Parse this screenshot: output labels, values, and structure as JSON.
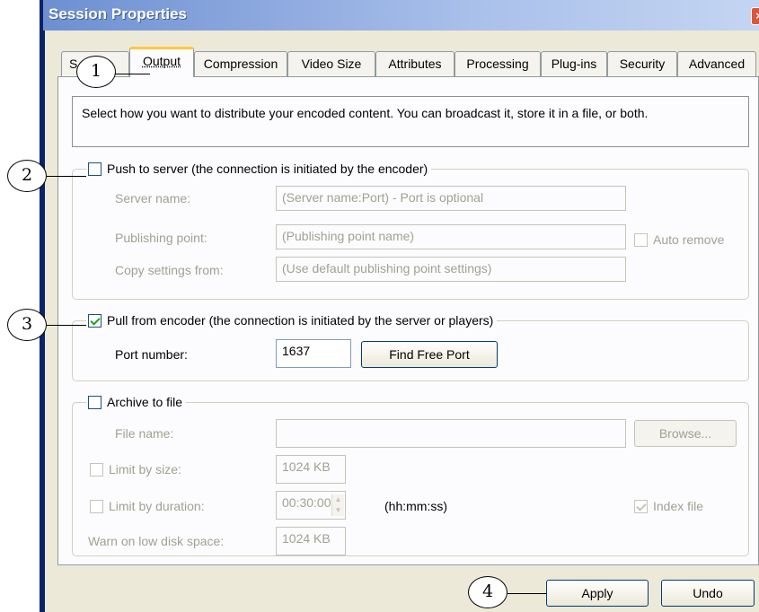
{
  "window": {
    "title": "Session Properties",
    "close_glyph": "×"
  },
  "tabs": [
    "Sources",
    "Output",
    "Compression",
    "Video Size",
    "Attributes",
    "Processing",
    "Plug-ins",
    "Security",
    "Advanced"
  ],
  "tab_visible_fragment_first": "S",
  "tab_visible_fragment_second": "es",
  "description": "Select how you want to distribute your encoded content. You can broadcast it, store it in a file, or both.",
  "push": {
    "label": "Push to server (the connection is initiated by the encoder)",
    "checked": false,
    "server_name_label": "Server name:",
    "server_name_value": "(Server name:Port)  - Port is optional",
    "publishing_point_label": "Publishing point:",
    "publishing_point_value": "(Publishing point name)",
    "auto_remove_label": "Auto remove",
    "copy_settings_label": "Copy settings from:",
    "copy_settings_value": "(Use default publishing point settings)"
  },
  "pull": {
    "label": "Pull from encoder (the connection is initiated by the server or players)",
    "checked": true,
    "port_label": "Port number:",
    "port_value": "1637",
    "find_port_button": "Find Free Port"
  },
  "archive": {
    "label": "Archive to file",
    "checked": false,
    "file_name_label": "File name:",
    "file_name_value": "",
    "browse_button": "Browse...",
    "limit_size_label": "Limit by size:",
    "limit_size_value": "1024 KB",
    "limit_duration_label": "Limit by duration:",
    "limit_duration_value": "00:30:00",
    "duration_format": "(hh:mm:ss)",
    "index_file_label": "Index file",
    "index_file_checked": true,
    "warn_label": "Warn on low disk space:",
    "warn_value": "1024 KB"
  },
  "footer": {
    "apply_button": "Apply",
    "undo_button": "Undo"
  },
  "callouts": [
    "1",
    "2",
    "3",
    "4"
  ],
  "colors": {
    "title_gradient_start": "#6d8fd2",
    "active_tab_accent": "#ffc83c",
    "checkbox_check": "#21a121",
    "dialog_bg": "#ece9d8"
  }
}
